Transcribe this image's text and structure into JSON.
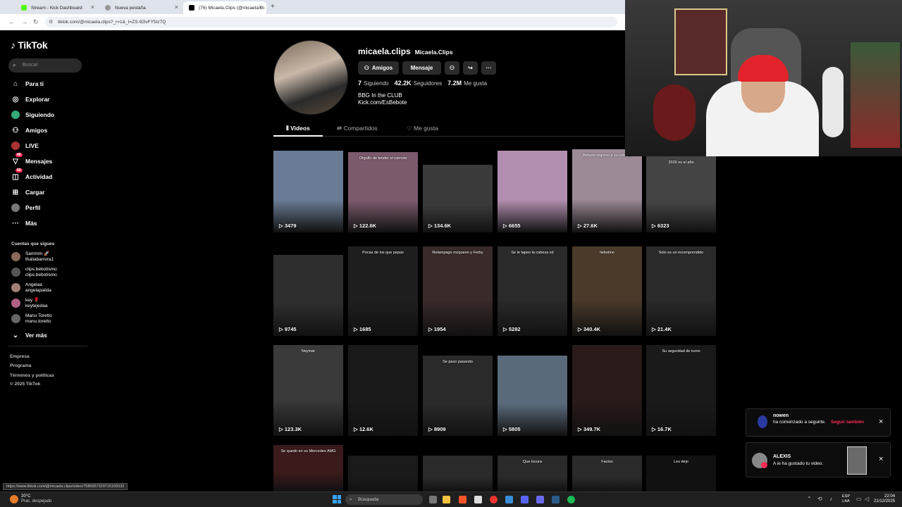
{
  "browser": {
    "tabs": [
      {
        "title": "Stream - Kick Dashboard",
        "color": "#53fc18"
      },
      {
        "title": "Nueva pestaña",
        "color": "#888"
      },
      {
        "title": "(76) Micaela.Clips (@micaela.cli",
        "color": "#000"
      }
    ],
    "url": "tiktok.com/@micaela.clips?_r=1&_t=ZS-92lvFY5Iz7Q",
    "status_url": "https://www.tiktok.com/@micaela.clips/video/7585657329715105032"
  },
  "sidebar": {
    "logo": "TikTok",
    "search_placeholder": "Buscar",
    "nav": [
      {
        "label": "Para ti",
        "icon": "home-icon"
      },
      {
        "label": "Explorar",
        "icon": "compass-icon"
      },
      {
        "label": "Siguiendo",
        "icon": "following-icon"
      },
      {
        "label": "Amigos",
        "icon": "friends-icon"
      },
      {
        "label": "LIVE",
        "icon": "live-icon"
      },
      {
        "label": "Mensajes",
        "icon": "messages-icon",
        "badge": "49"
      },
      {
        "label": "Actividad",
        "icon": "activity-icon",
        "badge": "99"
      },
      {
        "label": "Cargar",
        "icon": "upload-icon"
      },
      {
        "label": "Perfil",
        "icon": "profile-icon"
      },
      {
        "label": "Más",
        "icon": "more-icon"
      }
    ],
    "following_header": "Cuentas que sigues",
    "accounts": [
      {
        "name": "Sammm 🚀",
        "handle": "thaliabarrera1"
      },
      {
        "name": "clips.bebotismo",
        "handle": "clips.bebotismo"
      },
      {
        "name": "Angelaa",
        "handle": "angelapalida"
      },
      {
        "name": "key 🌹",
        "handle": "keytejedaa"
      },
      {
        "name": "Manu Toretto",
        "handle": "manu.toretto"
      }
    ],
    "see_more": "Ver más",
    "footer": [
      "Empresa",
      "Programa",
      "Términos y políticas",
      "© 2025 TikTok"
    ]
  },
  "profile": {
    "username": "micaela.clips",
    "display_name": "Micaela.Clips",
    "buttons": {
      "friends": "Amigos",
      "message": "Mensaje"
    },
    "stats": [
      {
        "value": "7",
        "label": "Siguiendo"
      },
      {
        "value": "42.2K",
        "label": "Seguidores"
      },
      {
        "value": "7.2M",
        "label": "Me gusta"
      }
    ],
    "bio": [
      "BBG In the CLUB",
      "Kick.com/EsBebote"
    ],
    "tabs": [
      "Videos",
      "Compartidos",
      "Me gusta"
    ]
  },
  "videos": [
    {
      "views": "3479",
      "caption": "",
      "bg": "#6a7c95"
    },
    {
      "views": "122.6K",
      "caption": "Orgullo de tender el camote",
      "bg": "#7b5a6c"
    },
    {
      "views": "134.6K",
      "caption": "",
      "bg": "#3a3a3a"
    },
    {
      "views": "6655",
      "caption": "",
      "bg": "#b28fb0"
    },
    {
      "views": "27.6K",
      "caption": "Bebote regreso a su colegio",
      "bg": "#9c8a96"
    },
    {
      "views": "6323",
      "caption": "2026 es el año",
      "bg": "#444"
    },
    {
      "views": "9745",
      "caption": "",
      "bg": "#2e2e2e"
    },
    {
      "views": "1685",
      "caption": "Pocas de los que pepas",
      "bg": "#1e1e1e"
    },
    {
      "views": "1954",
      "caption": "Relampago mcqueen y Ferby",
      "bg": "#3a2a2a"
    },
    {
      "views": "5282",
      "caption": "Se le tapeo la cabeza xd",
      "bg": "#2a2a2a"
    },
    {
      "views": "340.4K",
      "caption": "tiebotino",
      "bg": "#4a3a2a"
    },
    {
      "views": "21.4K",
      "caption": "Solo es un incomprendido",
      "bg": "#2a2a2a"
    },
    {
      "views": "123.3K",
      "caption": "Neymar",
      "bg": "#3a3a3a"
    },
    {
      "views": "12.6K",
      "caption": "",
      "bg": "#1a1a1a"
    },
    {
      "views": "8909",
      "caption": "Se paso pasando",
      "bg": "#2a2a2a"
    },
    {
      "views": "5805",
      "caption": "",
      "bg": "#5a6a7a"
    },
    {
      "views": "349.7K",
      "caption": "",
      "bg": "#2a1a1a"
    },
    {
      "views": "16.7K",
      "caption": "Su seguridad de turno",
      "bg": "#1a1a1a"
    },
    {
      "views": "",
      "caption": "Se quedo en su Mercedes AMG",
      "bg": "#3a1a1a"
    },
    {
      "views": "",
      "caption": "",
      "bg": "#1a1a1a"
    },
    {
      "views": "",
      "caption": "",
      "bg": "#2a2a2a"
    },
    {
      "views": "",
      "caption": "Que locura",
      "bg": "#2a2a2a"
    },
    {
      "views": "",
      "caption": "Factos",
      "bg": "#2a2a2a"
    },
    {
      "views": "",
      "caption": "Les dejo",
      "bg": "#111"
    }
  ],
  "notifications": [
    {
      "user": "nowen",
      "text": "ha comenzado a seguirte.",
      "action": "Seguir también"
    },
    {
      "user": "ALEXIS",
      "text": "A ie ha gustado tu video."
    }
  ],
  "taskbar": {
    "weather_temp": "20°C",
    "weather_desc": "Prac. despejado",
    "search": "Búsqueda",
    "lang": "ESP",
    "lang2": "LAA",
    "time": "22:04",
    "date": "21/12/2025"
  }
}
